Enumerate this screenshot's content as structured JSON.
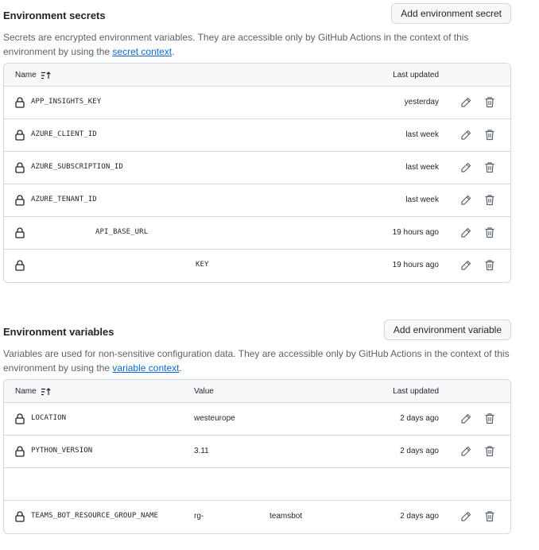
{
  "secrets": {
    "title": "Environment secrets",
    "add_button": "Add environment secret",
    "description": "Secrets are encrypted environment variables. They are accessible only by GitHub Actions in the context of this environment by using the ",
    "link": "secret context",
    "period": ".",
    "columns": {
      "name": "Name",
      "updated": "Last updated"
    },
    "rows": [
      {
        "name": "APP_INSIGHTS_KEY",
        "updated": "yesterday"
      },
      {
        "name": "AZURE_CLIENT_ID",
        "updated": "last week"
      },
      {
        "name": "AZURE_SUBSCRIPTION_ID",
        "updated": "last week"
      },
      {
        "name": "AZURE_TENANT_ID",
        "updated": "last week"
      },
      {
        "name": "API_BASE_URL",
        "updated": "19 hours ago"
      },
      {
        "name": "KEY",
        "updated": "19 hours ago"
      }
    ]
  },
  "variables": {
    "title": "Environment variables",
    "add_button": "Add environment variable",
    "description": "Variables are used for non-sensitive configuration data. They are accessible only by GitHub Actions in the context of this environment by using the ",
    "link": "variable context",
    "period": ".",
    "columns": {
      "name": "Name",
      "value": "Value",
      "updated": "Last updated"
    },
    "rows": [
      {
        "name": "LOCATION",
        "value": "westeurope",
        "updated": "2 days ago"
      },
      {
        "name": "PYTHON_VERSION",
        "value": "3.11",
        "updated": "2 days ago"
      },
      {
        "name": "",
        "value": "",
        "updated": ""
      },
      {
        "name": "TEAMS_BOT_RESOURCE_GROUP_NAME",
        "value": "rg-",
        "value2": "teamsbot",
        "updated": "2 days ago"
      }
    ]
  },
  "icons": {
    "lock": "lock-icon",
    "sort": "sort-ascending-icon",
    "edit": "pencil-icon",
    "delete": "trash-icon"
  },
  "colors": {
    "link": "#0969da",
    "border": "#d1d9e0",
    "header_bg": "#f6f8fa",
    "muted": "#59636e"
  }
}
